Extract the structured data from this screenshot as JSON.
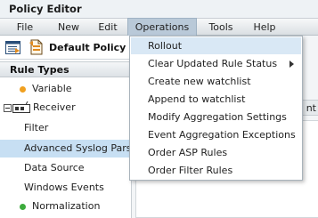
{
  "window": {
    "title": "Policy Editor"
  },
  "menubar": {
    "items": [
      {
        "label": "File"
      },
      {
        "label": "New"
      },
      {
        "label": "Edit"
      },
      {
        "label": "Operations"
      },
      {
        "label": "Tools"
      },
      {
        "label": "Help"
      }
    ],
    "active": "Operations"
  },
  "toolbar": {
    "policy_label": "Default Policy"
  },
  "rule_types": {
    "header": "Rule Types",
    "items": [
      {
        "label": "Variable",
        "icon": "orange-dot-icon",
        "color": "#f0a020"
      },
      {
        "label": "Receiver",
        "icon": "receiver-icon",
        "expanded": true
      },
      {
        "label": "Filter"
      },
      {
        "label": "Advanced Syslog Parser",
        "selected": true
      },
      {
        "label": "Data Source"
      },
      {
        "label": "Windows Events"
      },
      {
        "label": "Normalization",
        "icon": "green-dot-icon",
        "color": "#3cab3c"
      }
    ]
  },
  "background_tab_peek": "nt",
  "operations_menu": {
    "items": [
      {
        "label": "Rollout",
        "highlighted": true
      },
      {
        "label": "Clear Updated Rule Status",
        "has_submenu": true
      },
      {
        "label": "Create new watchlist"
      },
      {
        "label": "Append to watchlist"
      },
      {
        "label": "Modify Aggregation Settings"
      },
      {
        "label": "Event Aggregation Exceptions"
      },
      {
        "label": "Order ASP Rules"
      },
      {
        "label": "Order Filter Rules"
      }
    ]
  },
  "colors": {
    "highlight": "#d9e8f5",
    "selected_row": "#c7dff3",
    "menu_active": "#b9c9d8"
  }
}
